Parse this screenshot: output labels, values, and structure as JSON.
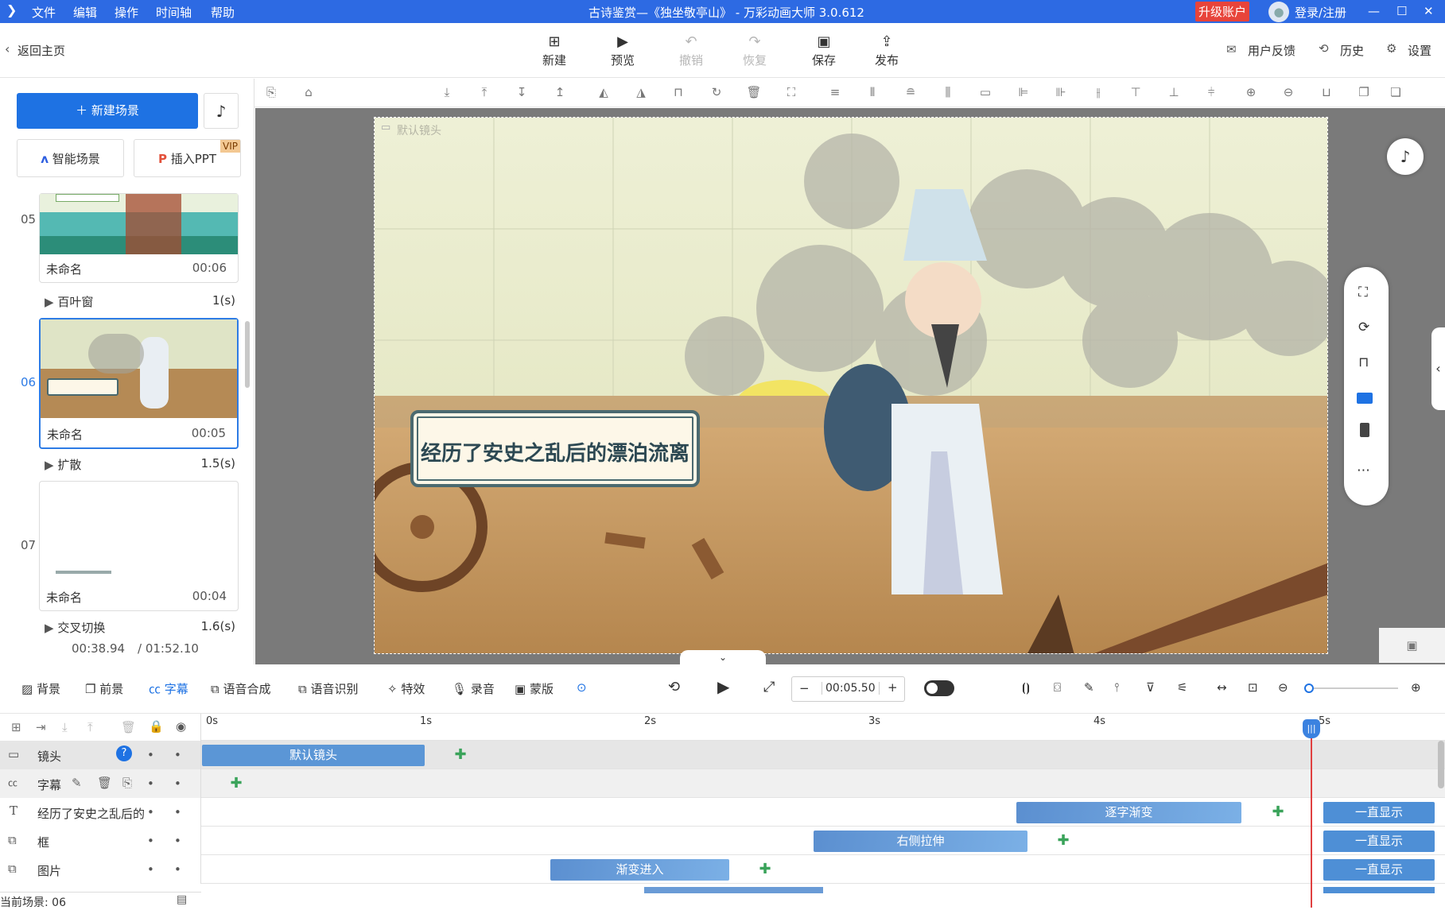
{
  "titlebar": {
    "menus": [
      "文件",
      "编辑",
      "操作",
      "时间轴",
      "帮助"
    ],
    "title": "古诗鉴赏—《独坐敬亭山》 - 万彩动画大师 3.0.612",
    "upgrade": "升级账户",
    "login": "登录/注册"
  },
  "toolbar": {
    "back": "返回主页",
    "buttons": [
      "新建",
      "预览",
      "撤销",
      "恢复",
      "保存",
      "发布"
    ],
    "feedback": "用户反馈",
    "history": "历史",
    "settings": "设置"
  },
  "left": {
    "new_scene": "新建场景",
    "smart_scene": "智能场景",
    "insert_ppt": "插入PPT",
    "vip": "VIP",
    "scenes": [
      {
        "num": "05",
        "name": "未命名",
        "duration": "00:06",
        "transition": "百叶窗",
        "trans_time": "1(s)"
      },
      {
        "num": "06",
        "name": "未命名",
        "duration": "00:05",
        "transition": "扩散",
        "trans_time": "1.5(s)"
      },
      {
        "num": "07",
        "name": "未命名",
        "duration": "00:04",
        "transition": "交叉切换",
        "trans_time": "1.6(s)"
      }
    ],
    "time_current": "00:38.94",
    "time_total": "/ 01:52.10"
  },
  "canvas": {
    "camera_label": "默认镜头",
    "caption": "经历了安史之乱后的漂泊流离"
  },
  "timebar": {
    "tabs": [
      "背景",
      "前景",
      "字幕",
      "语音合成",
      "语音识别",
      "特效",
      "录音",
      "蒙版"
    ],
    "time": "00:05.50"
  },
  "timeline": {
    "ruler": [
      "0s",
      "1s",
      "2s",
      "3s",
      "4s",
      "5s"
    ],
    "rows": [
      {
        "name": "镜头",
        "bars": [
          {
            "label": "默认镜头"
          }
        ]
      },
      {
        "name": "字幕",
        "bars": []
      },
      {
        "name": "经历了安史之乱后的",
        "bars": [
          {
            "label": "逐字渐变"
          },
          {
            "label": "一直显示"
          }
        ]
      },
      {
        "name": "框",
        "bars": [
          {
            "label": "右侧拉伸"
          },
          {
            "label": "一直显示"
          }
        ]
      },
      {
        "name": "图片",
        "bars": [
          {
            "label": "渐变进入"
          },
          {
            "label": "一直显示"
          }
        ]
      }
    ],
    "current_scene": "当前场景: 06"
  }
}
